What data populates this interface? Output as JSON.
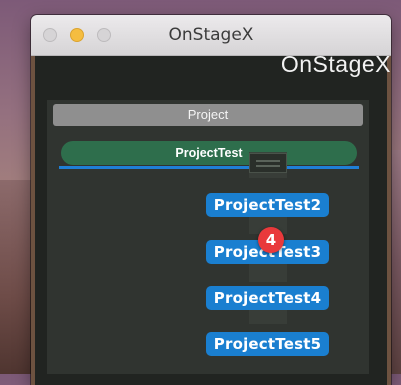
{
  "window": {
    "title": "OnStageX"
  },
  "app": {
    "title": "OnStageX"
  },
  "project": {
    "header_label": "Project",
    "current": "ProjectTest",
    "list": [
      "ProjectTest2",
      "ProjectTest3",
      "ProjectTest4",
      "ProjectTest5"
    ]
  },
  "drag_badge": {
    "count": "4"
  },
  "colors": {
    "accent": "#1a7fd0",
    "current_project": "#2e6e4c",
    "badge": "#e9393b"
  }
}
